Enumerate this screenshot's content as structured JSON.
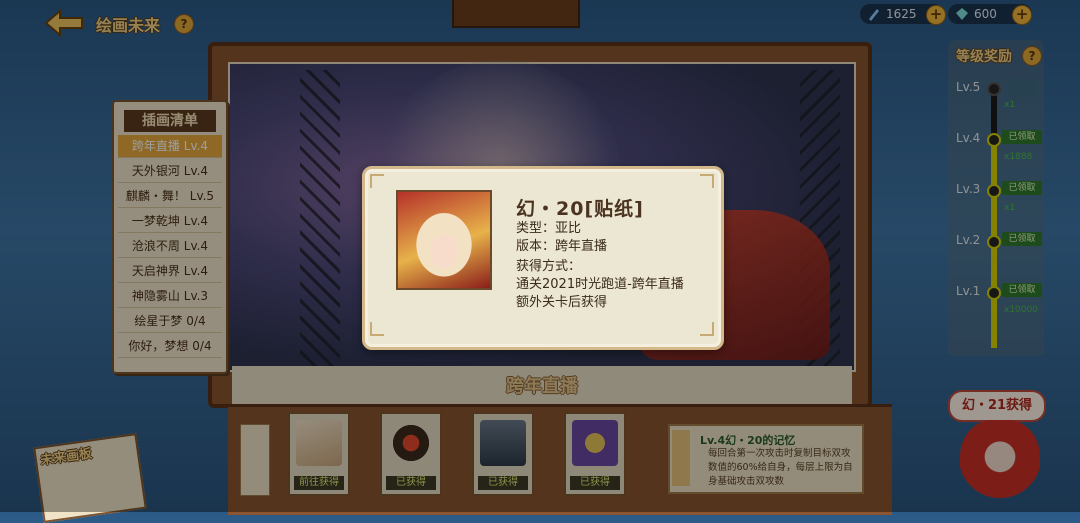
{
  "header": {
    "title": "绘画未来",
    "resources": [
      {
        "name": "pen-resource",
        "value": "1625"
      },
      {
        "name": "crystal-resource",
        "value": "600"
      }
    ]
  },
  "illustration_list": {
    "title": "插画清单",
    "items": [
      {
        "name": "跨年直播",
        "level": "Lv.4",
        "active": true
      },
      {
        "name": "天外银河",
        "level": "Lv.4"
      },
      {
        "name": "麒麟・舞！",
        "level": "Lv.5"
      },
      {
        "name": "一梦乾坤",
        "level": "Lv.4"
      },
      {
        "name": "沧浪不周",
        "level": "Lv.4"
      },
      {
        "name": "天启神界",
        "level": "Lv.4"
      },
      {
        "name": "神隐雾山",
        "level": "Lv.3"
      },
      {
        "name": "绘星于梦",
        "level": "0/4"
      },
      {
        "name": "你好，梦想",
        "level": "0/4"
      }
    ]
  },
  "canvas": {
    "title": "跨年直播"
  },
  "level_rewards": {
    "title": "等级奖励",
    "levels": [
      {
        "label": "Lv.5",
        "status": "",
        "reward_sub": "x1"
      },
      {
        "label": "Lv.4",
        "status": "已领取",
        "reward_sub": "x1888"
      },
      {
        "label": "Lv.3",
        "status": "已领取",
        "reward_sub": "x1"
      },
      {
        "label": "Lv.2",
        "status": "已领取",
        "reward_sub": ""
      },
      {
        "label": "Lv.1",
        "status": "已领取",
        "reward_sub": "x10000"
      }
    ],
    "progress_levels": 4
  },
  "bottom_items": [
    {
      "label": "前往获得"
    },
    {
      "label": "已获得"
    },
    {
      "label": "已获得"
    },
    {
      "label": "已获得"
    }
  ],
  "skill_desc": {
    "title": "Lv.4幻・20的记忆",
    "text": "每回合第一次攻击时复制目标双攻数值的60%给自身，每层上限为自身基础攻击双攻数"
  },
  "future_board": {
    "title": "未来画板"
  },
  "next_reward": {
    "label": "幻・21获得"
  },
  "modal": {
    "title": "幻・20[贴纸]",
    "type_line": "类型：亚比",
    "version_line": "版本：跨年直播",
    "obtain_heading": "获得方式：",
    "obtain_line1": "通关2021时光跑道-跨年直播",
    "obtain_line2": "额外关卡后获得"
  }
}
